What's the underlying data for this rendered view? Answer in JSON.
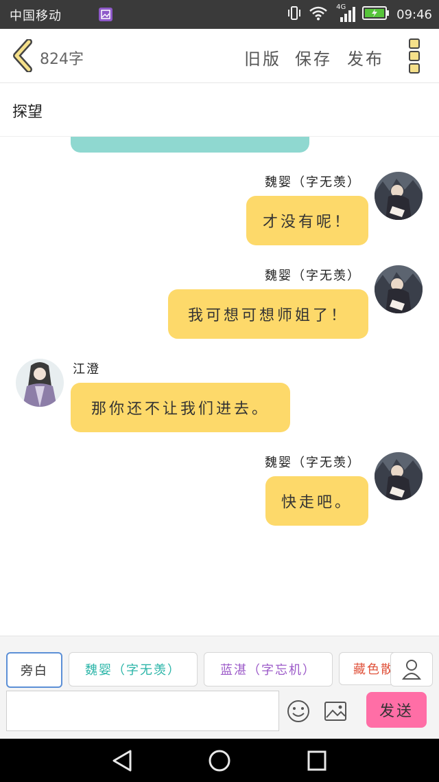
{
  "status_bar": {
    "carrier": "中国移动",
    "network": "4G",
    "time": "09:46"
  },
  "header": {
    "word_count": "824字",
    "menu": [
      "旧版",
      "保存",
      "发布"
    ]
  },
  "page": {
    "title": "探望"
  },
  "messages": [
    {
      "side": "right",
      "name": "魏婴（字无羡）",
      "text": "才没有呢！"
    },
    {
      "side": "right",
      "name": "魏婴（字无羡）",
      "text": "我可想可想师姐了！"
    },
    {
      "side": "left",
      "name": "江澄",
      "text": "那你还不让我们进去。"
    },
    {
      "side": "right",
      "name": "魏婴（字无羡）",
      "text": "快走吧。"
    }
  ],
  "character_chips": [
    {
      "label": "旁白",
      "color": "#333333"
    },
    {
      "label": "魏婴（字无羡）",
      "color": "#2bb5a8"
    },
    {
      "label": "蓝湛（字忘机）",
      "color": "#9b59c8"
    },
    {
      "label": "藏色散人",
      "color": "#e0533c"
    }
  ],
  "composer": {
    "placeholder": "",
    "send_label": "发送"
  },
  "colors": {
    "bubble": "#fdd96a",
    "send": "#ff6ea6",
    "teal_bubble": "#8fd8d0"
  }
}
